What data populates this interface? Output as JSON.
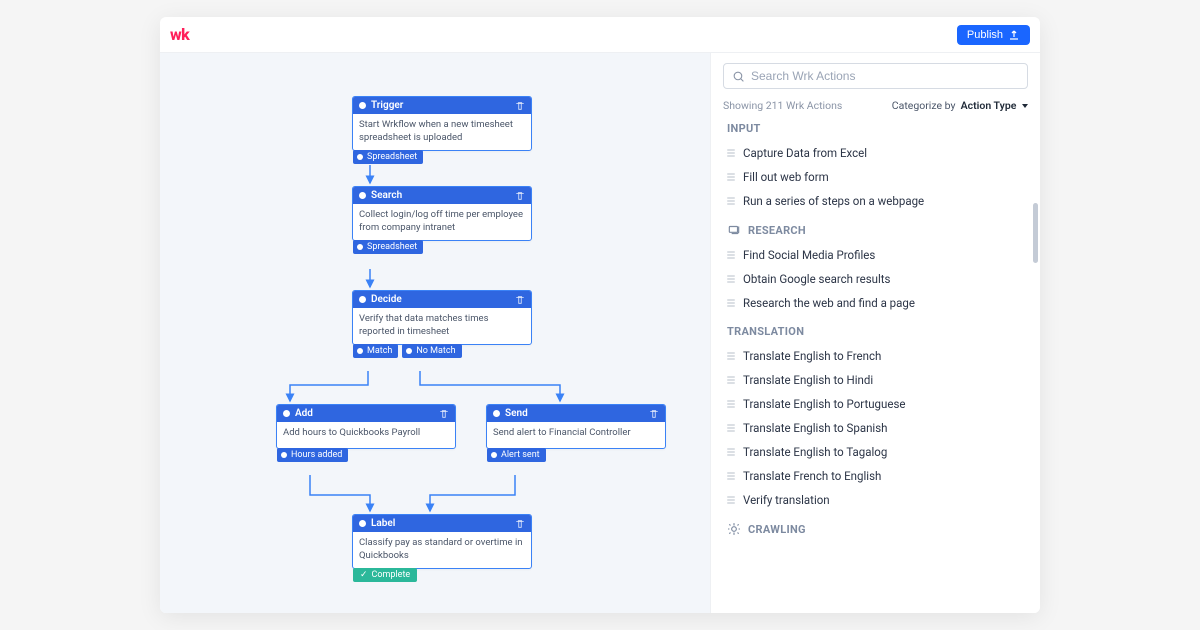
{
  "header": {
    "logo_text": "wk",
    "publish_label": "Publish"
  },
  "workflow": {
    "nodes": {
      "trigger": {
        "title": "Trigger",
        "body": "Start Wrkflow when a new timesheet spreadsheet is uploaded",
        "outputs": [
          "Spreadsheet"
        ]
      },
      "search": {
        "title": "Search",
        "body": "Collect login/log off time per employee from company intranet",
        "outputs": [
          "Spreadsheet"
        ]
      },
      "decide": {
        "title": "Decide",
        "body": "Verify that data matches times reported in timesheet",
        "outputs": [
          "Match",
          "No Match"
        ]
      },
      "add": {
        "title": "Add",
        "body": "Add hours to Quickbooks Payroll",
        "outputs": [
          "Hours added"
        ]
      },
      "send": {
        "title": "Send",
        "body": "Send alert to Financial Controller",
        "outputs": [
          "Alert sent"
        ]
      },
      "label": {
        "title": "Label",
        "body": "Classify pay as standard or overtime in Quickbooks",
        "complete": "Complete"
      }
    }
  },
  "sidebar": {
    "search_placeholder": "Search Wrk Actions",
    "count_text": "Showing 211 Wrk Actions",
    "categorize_label": "Categorize by",
    "categorize_value": "Action Type",
    "categories": [
      {
        "name": "INPUT",
        "items": [
          "Capture Data from Excel",
          "Fill out web form",
          "Run a series of steps on a webpage"
        ]
      },
      {
        "name": "RESEARCH",
        "items": [
          "Find Social Media Profiles",
          "Obtain Google search results",
          "Research the web and find a page"
        ]
      },
      {
        "name": "TRANSLATION",
        "items": [
          "Translate English to French",
          "Translate English to Hindi",
          "Translate English to Portuguese",
          "Translate English to Spanish",
          "Translate English to Tagalog",
          "Translate French to English",
          "Verify translation"
        ]
      },
      {
        "name": "CRAWLING",
        "items": []
      }
    ]
  }
}
